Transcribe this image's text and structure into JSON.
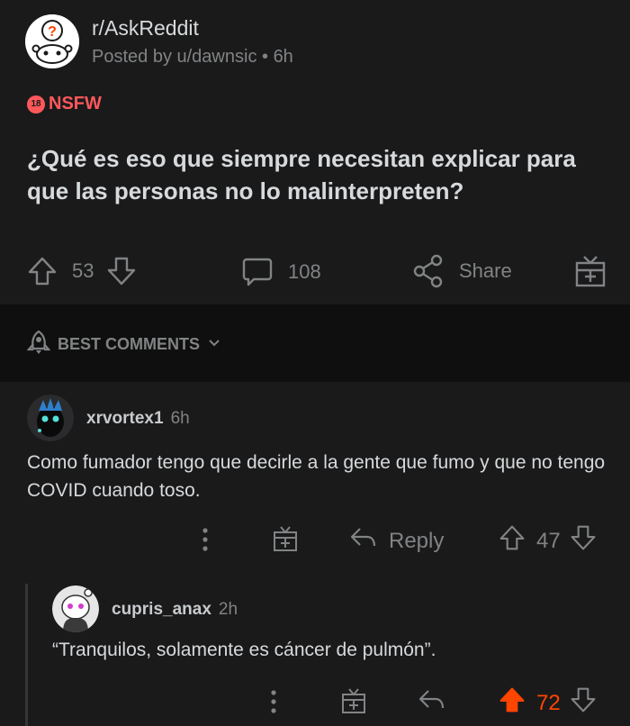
{
  "post": {
    "subreddit": "r/AskReddit",
    "posted_by": "Posted by u/dawnsic",
    "age": "6h",
    "nsfw_badge": "18",
    "nsfw_label": "NSFW",
    "title": "¿Qué es eso que siempre necesitan explicar para que las personas no lo malinterpreten?",
    "votes": "53",
    "comments": "108",
    "share_label": "Share"
  },
  "sort": {
    "label": "BEST COMMENTS"
  },
  "comments": [
    {
      "user": "xrvortex1",
      "age": "6h",
      "body": "Como fumador tengo que decirle a la gente que fumo y que no tengo COVID cuando toso.",
      "reply_label": "Reply",
      "votes": "47"
    },
    {
      "user": "cupris_anax",
      "age": "2h",
      "body": "“Tranquilos, solamente es cáncer de pulmón”.",
      "votes": "72"
    }
  ],
  "colors": {
    "background": "#1a1a1b",
    "sort_bar": "#0f0f0f",
    "nsfw": "#ff585b",
    "upvoted": "#ff4500",
    "muted": "#818384"
  }
}
